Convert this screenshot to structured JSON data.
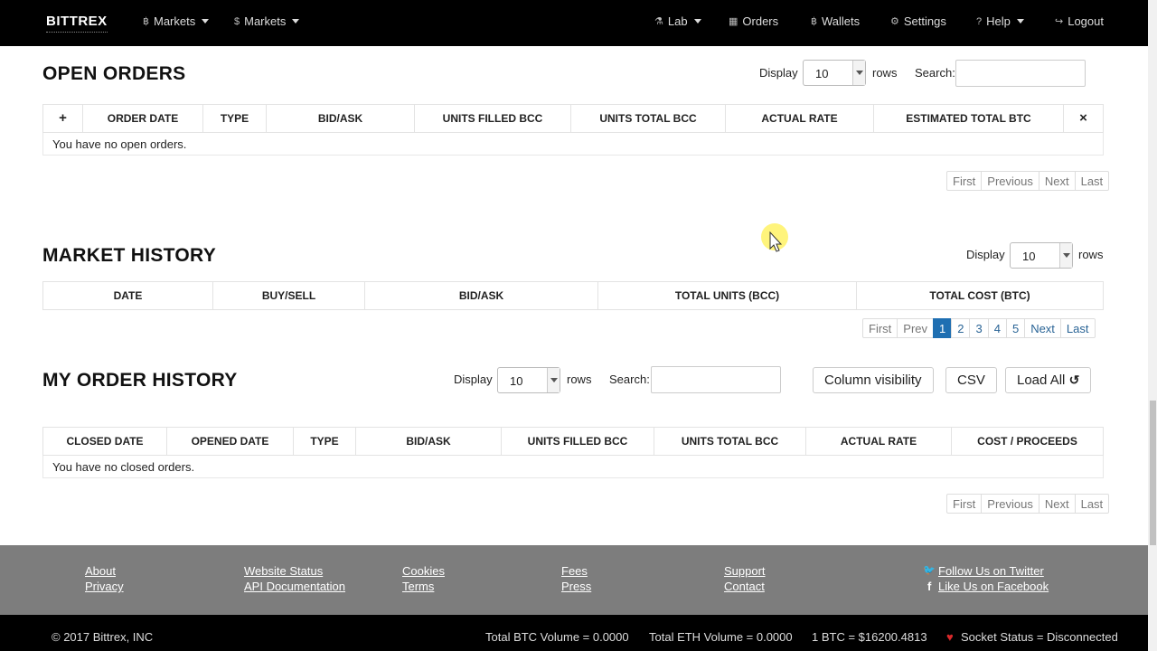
{
  "navbar": {
    "brand": "BITTREX",
    "left_items": [
      {
        "icon": "bitcoin-icon",
        "glyph": "฿",
        "label": "Markets"
      },
      {
        "icon": "dollar-icon",
        "glyph": "$",
        "label": "Markets"
      }
    ],
    "right_items": [
      {
        "icon": "flask-icon",
        "glyph": "⚗",
        "label": "Lab"
      },
      {
        "icon": "calendar-icon",
        "glyph": "▦",
        "label": "Orders"
      },
      {
        "icon": "bitcoin-icon",
        "glyph": "฿",
        "label": "Wallets"
      },
      {
        "icon": "gear-icon",
        "glyph": "⚙",
        "label": "Settings"
      },
      {
        "icon": "help-icon",
        "glyph": "?",
        "label": "Help"
      },
      {
        "icon": "logout-icon",
        "glyph": "↪",
        "label": "Logout"
      }
    ]
  },
  "open_orders": {
    "title": "OPEN ORDERS",
    "display_label": "Display",
    "display_value": "10",
    "rows_label": "rows",
    "search_label": "Search:",
    "columns": [
      "+",
      "ORDER DATE",
      "TYPE",
      "BID/ASK",
      "UNITS FILLED BCC",
      "UNITS TOTAL BCC",
      "ACTUAL RATE",
      "ESTIMATED TOTAL BTC",
      "×"
    ],
    "empty_text": "You have no open orders.",
    "pager": [
      "First",
      "Previous",
      "Next",
      "Last"
    ]
  },
  "market_history": {
    "title": "MARKET HISTORY",
    "display_label": "Display",
    "display_value": "10",
    "rows_label": "rows",
    "columns": [
      "DATE",
      "BUY/SELL",
      "BID/ASK",
      "TOTAL UNITS (BCC)",
      "TOTAL COST (BTC)"
    ],
    "pager": [
      "First",
      "Prev",
      "1",
      "2",
      "3",
      "4",
      "5",
      "Next",
      "Last"
    ]
  },
  "my_order_history": {
    "title": "MY ORDER HISTORY",
    "display_label": "Display",
    "display_value": "10",
    "rows_label": "rows",
    "search_label": "Search:",
    "buttons": {
      "column_visibility": "Column visibility",
      "csv": "CSV",
      "load_all": "Load All"
    },
    "columns": [
      "CLOSED DATE",
      "OPENED DATE",
      "TYPE",
      "BID/ASK",
      "UNITS FILLED BCC",
      "UNITS TOTAL BCC",
      "ACTUAL RATE",
      "COST / PROCEEDS"
    ],
    "empty_text": "You have no closed orders.",
    "pager": [
      "First",
      "Previous",
      "Next",
      "Last"
    ]
  },
  "footer": {
    "links": [
      [
        "About",
        "Privacy"
      ],
      [
        "Website Status",
        "API Documentation"
      ],
      [
        "Cookies",
        "Terms"
      ],
      [
        "Fees",
        "Press"
      ],
      [
        "Support",
        "Contact"
      ],
      [
        "Follow Us on Twitter",
        "Like Us on Facebook"
      ]
    ],
    "copyright": "© 2017 Bittrex, INC",
    "btc_volume": "Total BTC Volume = 0.0000",
    "eth_volume": "Total ETH Volume = 0.0000",
    "btc_price": "1 BTC = $16200.4813",
    "socket_status": "Socket Status = Disconnected"
  },
  "colors": {
    "navbar": "#000000",
    "footer": "#7d7d7d",
    "active_page": "#1f6fb2",
    "socket_status": "#d9292b"
  }
}
